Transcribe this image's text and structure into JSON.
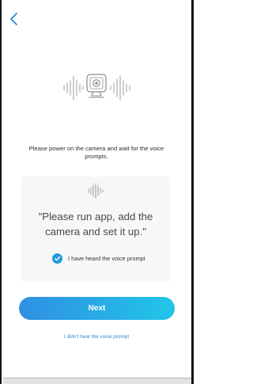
{
  "header": {
    "back_icon": "chevron-left-icon"
  },
  "hero": {
    "icon": "camera-icon",
    "left_wave_icon": "sound-wave-icon",
    "right_wave_icon": "sound-wave-icon"
  },
  "instruction_text": "Please power on the camera and wait for the voice prompts.",
  "prompt_card": {
    "wave_icon": "sound-wave-icon",
    "quote": "\"Please run app, add the camera and set it up.\"",
    "checkbox_label": "I have heard the voice prompt",
    "checkbox_checked": true
  },
  "next_label": "Next",
  "didnt_hear_label": "I didn't hear the voice prompt",
  "colors": {
    "accent": "#1e9bdc",
    "button_gradient_start": "#2f8fe3",
    "button_gradient_end": "#22c6e8",
    "link": "#2d88d8",
    "card_background": "#f6f7f9"
  }
}
